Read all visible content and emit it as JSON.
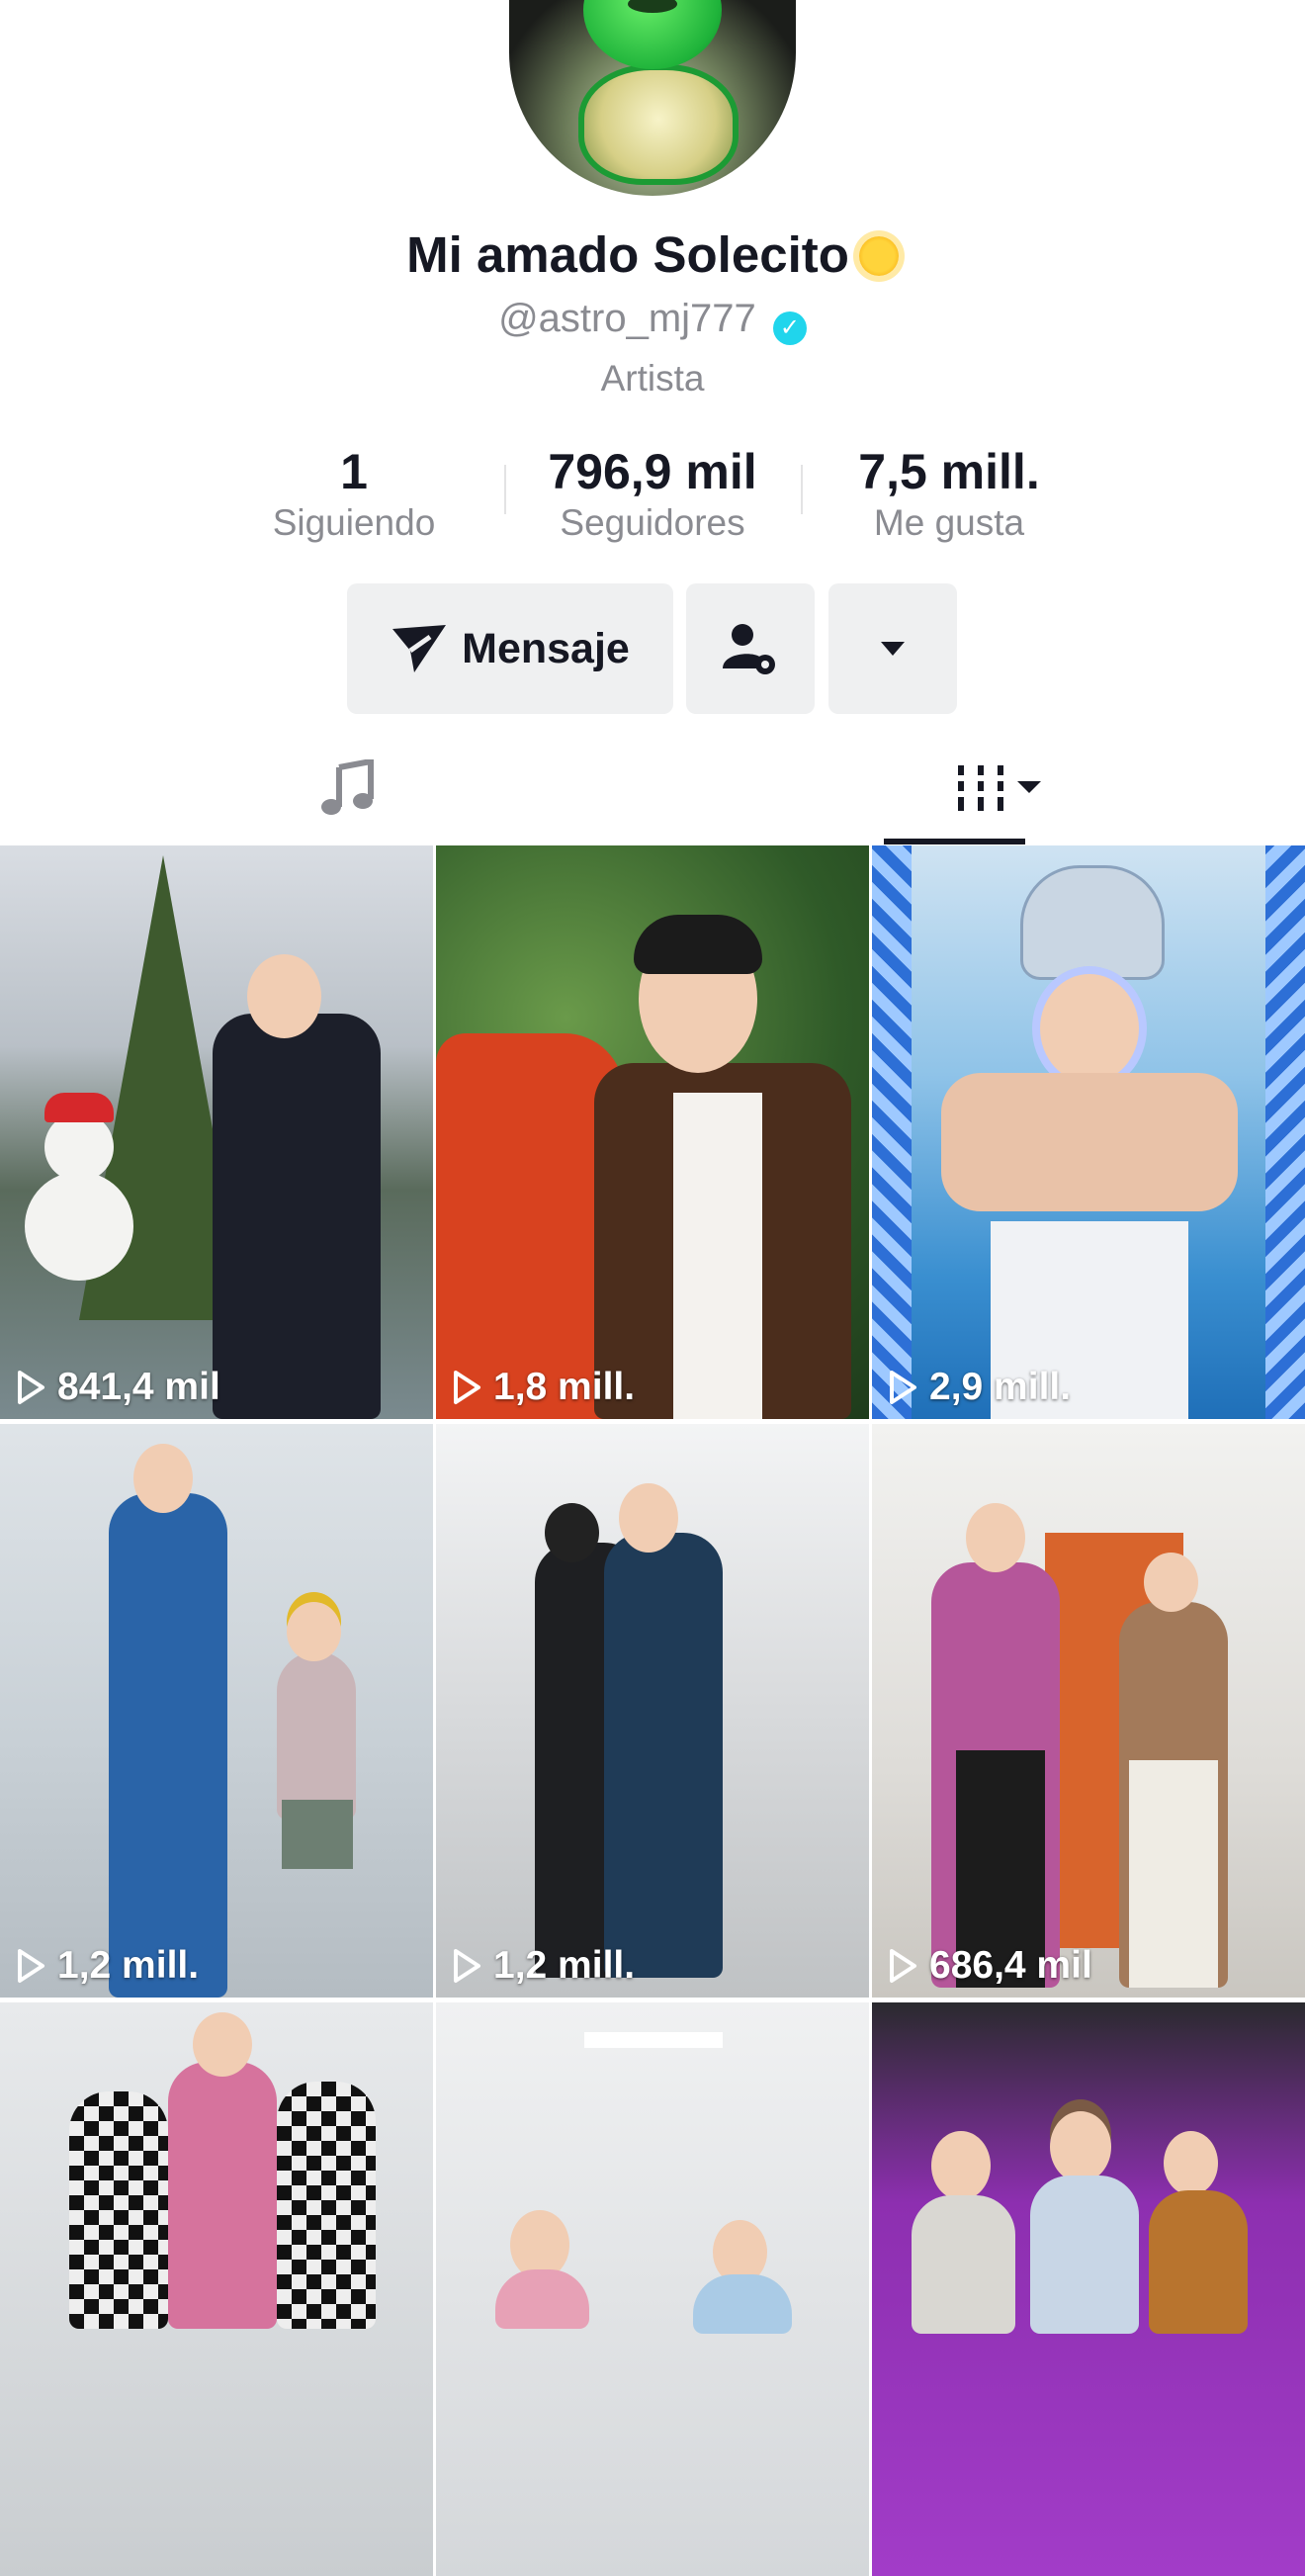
{
  "profile": {
    "display_name": "Mi amado Solecito",
    "emoji_icon": "sun-emoji-icon",
    "username": "@astro_mj777",
    "verified_icon": "verified-check-icon",
    "category": "Artista"
  },
  "stats": [
    {
      "value": "1",
      "label": "Siguiendo"
    },
    {
      "value": "796,9 mil",
      "label": "Seguidores"
    },
    {
      "value": "7,5 mill.",
      "label": "Me gusta"
    }
  ],
  "actions": {
    "message_label": "Mensaje",
    "message_icon": "send-icon",
    "follow_settings_icon": "person-settings-icon",
    "more_icon": "caret-down-icon"
  },
  "tabs": [
    {
      "icon": "music-note-icon",
      "active": false
    },
    {
      "icon": "videos-grid-filter-icon",
      "active": true
    }
  ],
  "videos": [
    {
      "views": "841,4 mil",
      "scene": "christmas tree and snowman"
    },
    {
      "views": "1,8 mill.",
      "scene": "man with plants"
    },
    {
      "views": "2,9 mill.",
      "scene": "crocs hat filter heart hands"
    },
    {
      "views": "1,2 mill.",
      "scene": "man in blue suit with child"
    },
    {
      "views": "1,2 mill.",
      "scene": "two people hugging in hallway"
    },
    {
      "views": "686,4 mil",
      "scene": "two men dancing by orange door"
    },
    {
      "views": "",
      "scene": "three men dancing in hallway"
    },
    {
      "views": "",
      "scene": "two men in office corridor"
    },
    {
      "views": "",
      "scene": "three men on purple stage"
    }
  ],
  "colors": {
    "text_primary": "#161823",
    "text_secondary": "#8a8b91",
    "button_bg": "#eff0f1",
    "verified": "#20d5ec"
  }
}
